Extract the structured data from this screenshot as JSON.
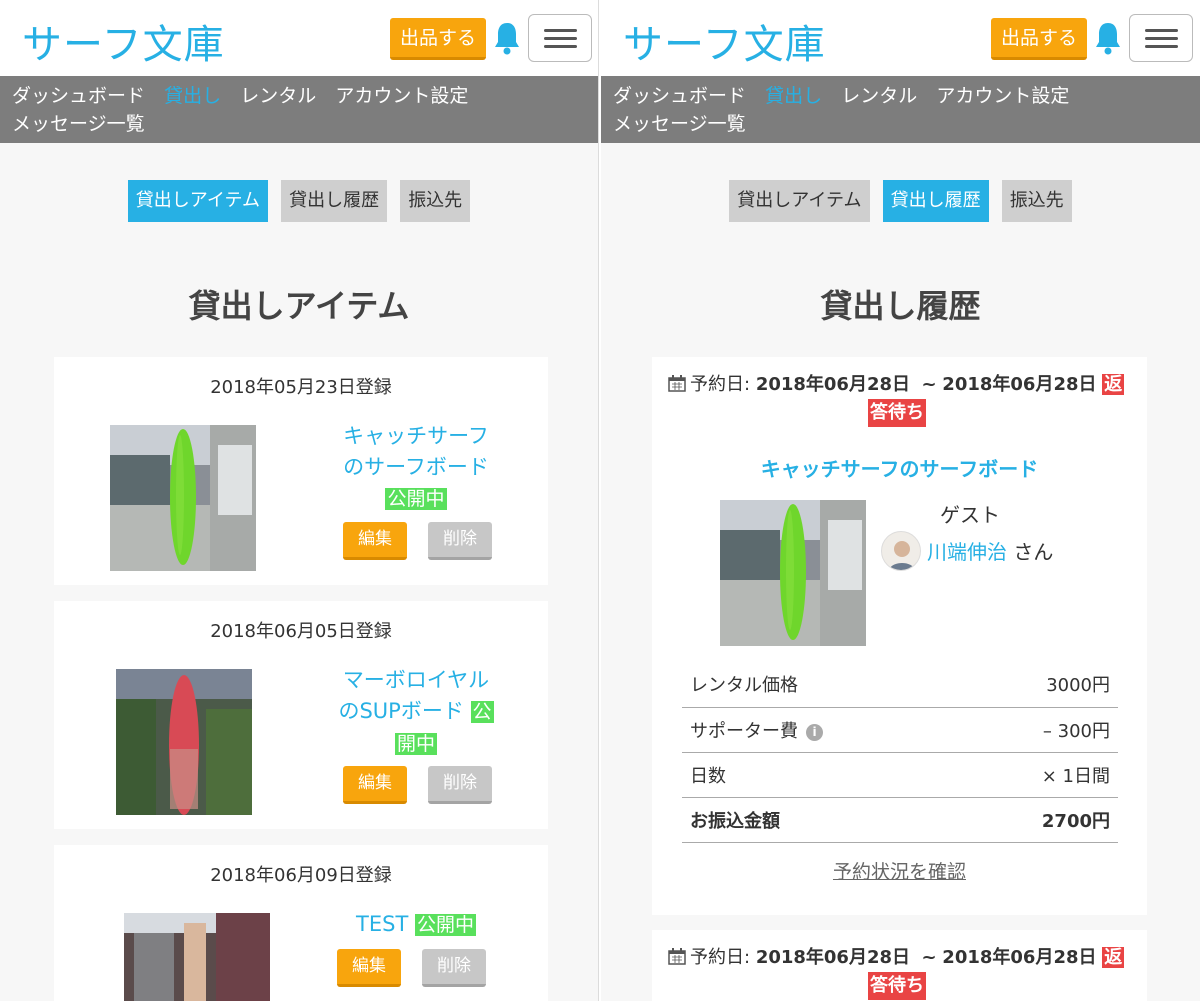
{
  "header": {
    "logo": "サーフ文庫",
    "list_button": "出品する",
    "nav": [
      "ダッシュボード",
      "貸出し",
      "レンタル",
      "アカウント設定",
      "メッセージ一覧"
    ]
  },
  "tabs": [
    "貸出しアイテム",
    "貸出し履歴",
    "振込先"
  ],
  "left": {
    "title": "貸出しアイテム",
    "items": [
      {
        "date": "2018年05月23日登録",
        "title_1": "キャッチサーフ",
        "title_2": "のサーフボード",
        "status": "公開中",
        "edit": "編集",
        "delete": "削除"
      },
      {
        "date": "2018年06月05日登録",
        "title_1": "マーボロイヤル",
        "title_2": "のSUPボード",
        "status_a": "公",
        "status_b": "開中",
        "edit": "編集",
        "delete": "削除"
      },
      {
        "date": "2018年06月09日登録",
        "title_1": "TEST",
        "status": "公開中",
        "edit": "編集",
        "delete": "削除"
      }
    ]
  },
  "right": {
    "title": "貸出し履歴",
    "reservation": {
      "label": "予約日:",
      "start": "2018年06月28日",
      "sep": "~",
      "end": "2018年06月28日",
      "badge_a": "返",
      "badge_b": "答待ち",
      "item_title": "キャッチサーフのサーフボード",
      "guest_label": "ゲスト",
      "guest_name": "川端伸治",
      "guest_suffix": "さん",
      "rows": [
        {
          "label": "レンタル価格",
          "value": "3000円"
        },
        {
          "label": "サポーター費",
          "value": "– 300円"
        },
        {
          "label": "日数",
          "value": "× 1日間"
        },
        {
          "label": "お振込金額",
          "value": "2700円"
        }
      ],
      "confirm": "予約状況を確認"
    },
    "reservation2": {
      "label": "予約日:",
      "start": "2018年06月28日",
      "sep": "~",
      "end": "2018年06月28日",
      "badge_a": "返",
      "badge_b": "答待ち"
    }
  },
  "colors": {
    "accent": "#27b0e4",
    "orange": "#f8a50d",
    "public": "#59e05c",
    "badge": "#e94444",
    "nav_bg": "#7d7d7d"
  }
}
